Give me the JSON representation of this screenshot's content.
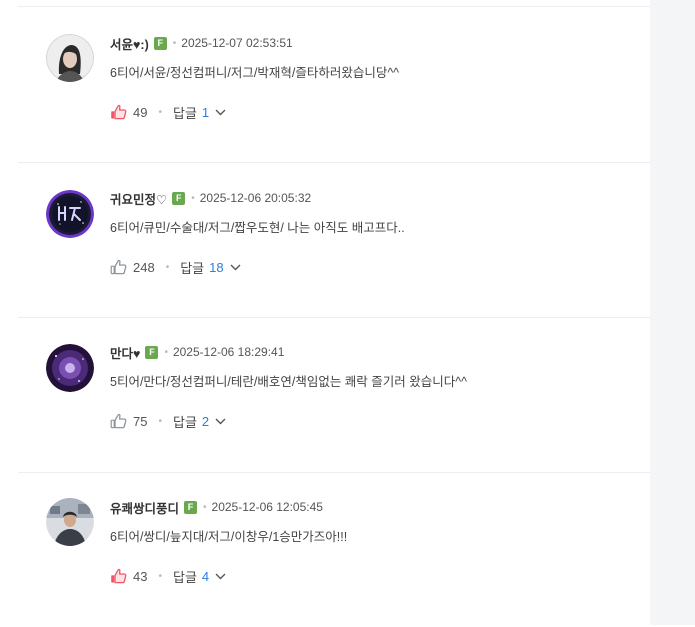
{
  "comments": [
    {
      "nickname": "서윤♥:)",
      "badge": "F",
      "date": "2025-12-07 02:53:51",
      "text": "6티어/서윤/정선컴퍼니/저그/박재혁/즐타하러왔습니당^^",
      "likes": "49",
      "liked": true,
      "reply_label": "답글",
      "reply_count": "1"
    },
    {
      "nickname": "귀요민정♡",
      "badge": "F",
      "date": "2025-12-06 20:05:32",
      "text": "6티어/큐민/수술대/저그/짭우도현/ 나는 아직도 배고프다..",
      "likes": "248",
      "liked": false,
      "reply_label": "답글",
      "reply_count": "18"
    },
    {
      "nickname": "만다♥",
      "badge": "F",
      "date": "2025-12-06 18:29:41",
      "text": "5티어/만다/정선컴퍼니/테란/배호연/책임없는 쾌락 즐기러 왔습니다^^",
      "likes": "75",
      "liked": false,
      "reply_label": "답글",
      "reply_count": "2"
    },
    {
      "nickname": "유쾌쌍디풍디",
      "badge": "F",
      "date": "2025-12-06 12:05:45",
      "text": "6티어/쌍디/늪지대/저그/이창우/1승만가즈아!!!",
      "likes": "43",
      "liked": true,
      "reply_label": "답글",
      "reply_count": "4"
    }
  ],
  "colors": {
    "like_active": "#f0566b",
    "like_inactive": "#8f959c",
    "reply_count": "#2a7de1",
    "badge_green": "#6aa84f"
  },
  "icons": {
    "like": "thumbs-up-icon",
    "expand": "chevron-down-icon"
  }
}
